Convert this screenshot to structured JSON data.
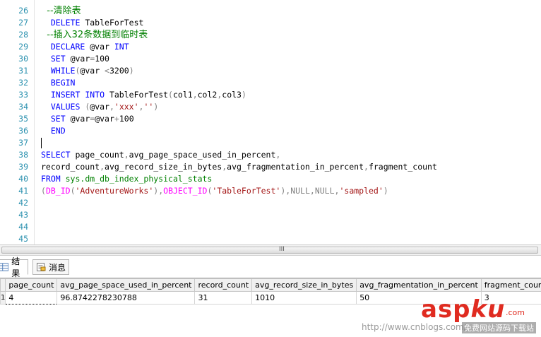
{
  "editor": {
    "lines": [
      {
        "n": "26",
        "segments": [
          {
            "t": "  --清除表",
            "c": "cmt"
          }
        ]
      },
      {
        "n": "27",
        "segments": [
          {
            "t": "  ",
            "c": ""
          },
          {
            "t": "DELETE",
            "c": "kw"
          },
          {
            "t": " TableForTest",
            "c": ""
          }
        ]
      },
      {
        "n": "28",
        "segments": [
          {
            "t": "  --插入32条数据到临时表",
            "c": "cmt"
          }
        ]
      },
      {
        "n": "29",
        "segments": [
          {
            "t": "  ",
            "c": ""
          },
          {
            "t": "DECLARE",
            "c": "kw"
          },
          {
            "t": " @var ",
            "c": ""
          },
          {
            "t": "INT",
            "c": "kw"
          }
        ]
      },
      {
        "n": "30",
        "segments": [
          {
            "t": "  ",
            "c": ""
          },
          {
            "t": "SET",
            "c": "kw"
          },
          {
            "t": " @var",
            "c": ""
          },
          {
            "t": "=",
            "c": "gray"
          },
          {
            "t": "100",
            "c": ""
          }
        ]
      },
      {
        "n": "31",
        "segments": [
          {
            "t": "  ",
            "c": ""
          },
          {
            "t": "WHILE",
            "c": "kw"
          },
          {
            "t": "(",
            "c": "gray"
          },
          {
            "t": "@var ",
            "c": ""
          },
          {
            "t": "<",
            "c": "gray"
          },
          {
            "t": "3200",
            "c": ""
          },
          {
            "t": ")",
            "c": "gray"
          }
        ]
      },
      {
        "n": "32",
        "segments": [
          {
            "t": "  ",
            "c": ""
          },
          {
            "t": "BEGIN",
            "c": "kw"
          }
        ]
      },
      {
        "n": "33",
        "segments": [
          {
            "t": "  ",
            "c": ""
          },
          {
            "t": "INSERT INTO",
            "c": "kw"
          },
          {
            "t": " TableForTest",
            "c": ""
          },
          {
            "t": "(",
            "c": "gray"
          },
          {
            "t": "col1",
            "c": ""
          },
          {
            "t": ",",
            "c": "gray"
          },
          {
            "t": "col2",
            "c": ""
          },
          {
            "t": ",",
            "c": "gray"
          },
          {
            "t": "col3",
            "c": ""
          },
          {
            "t": ")",
            "c": "gray"
          }
        ]
      },
      {
        "n": "34",
        "segments": [
          {
            "t": "  ",
            "c": ""
          },
          {
            "t": "VALUES",
            "c": "kw"
          },
          {
            "t": " (",
            "c": "gray"
          },
          {
            "t": "@var",
            "c": ""
          },
          {
            "t": ",",
            "c": "gray"
          },
          {
            "t": "'xxx'",
            "c": "str"
          },
          {
            "t": ",",
            "c": "gray"
          },
          {
            "t": "''",
            "c": "str"
          },
          {
            "t": ")",
            "c": "gray"
          }
        ]
      },
      {
        "n": "35",
        "segments": [
          {
            "t": "  ",
            "c": ""
          },
          {
            "t": "SET",
            "c": "kw"
          },
          {
            "t": " @var",
            "c": ""
          },
          {
            "t": "=",
            "c": "gray"
          },
          {
            "t": "@var",
            "c": ""
          },
          {
            "t": "+",
            "c": "gray"
          },
          {
            "t": "100",
            "c": ""
          }
        ]
      },
      {
        "n": "36",
        "segments": [
          {
            "t": "  ",
            "c": ""
          },
          {
            "t": "END",
            "c": "kw"
          }
        ]
      },
      {
        "n": "37",
        "segments": []
      },
      {
        "n": "38",
        "segments": [
          {
            "t": "SELECT",
            "c": "kw"
          },
          {
            "t": " page_count",
            "c": ""
          },
          {
            "t": ",",
            "c": "gray"
          },
          {
            "t": "avg_page_space_used_in_percent",
            "c": ""
          },
          {
            "t": ",",
            "c": "gray"
          }
        ]
      },
      {
        "n": "39",
        "segments": [
          {
            "t": "record_count",
            "c": ""
          },
          {
            "t": ",",
            "c": "gray"
          },
          {
            "t": "avg_record_size_in_bytes",
            "c": ""
          },
          {
            "t": ",",
            "c": "gray"
          },
          {
            "t": "avg_fragmentation_in_percent",
            "c": ""
          },
          {
            "t": ",",
            "c": "gray"
          },
          {
            "t": "fragment_count",
            "c": ""
          }
        ]
      },
      {
        "n": "40",
        "segments": [
          {
            "t": "FROM",
            "c": "kw"
          },
          {
            "t": " sys.dm_db_index_physical_stats",
            "c": "sys"
          }
        ]
      },
      {
        "n": "41",
        "segments": [
          {
            "t": "(",
            "c": "gray"
          },
          {
            "t": "DB_ID",
            "c": "fn"
          },
          {
            "t": "(",
            "c": "gray"
          },
          {
            "t": "'AdventureWorks'",
            "c": "str"
          },
          {
            "t": "),",
            "c": "gray"
          },
          {
            "t": "OBJECT_ID",
            "c": "fn"
          },
          {
            "t": "(",
            "c": "gray"
          },
          {
            "t": "'TableForTest'",
            "c": "str"
          },
          {
            "t": "),",
            "c": "gray"
          },
          {
            "t": "NULL",
            "c": "gray"
          },
          {
            "t": ",",
            "c": "gray"
          },
          {
            "t": "NULL",
            "c": "gray"
          },
          {
            "t": ",",
            "c": "gray"
          },
          {
            "t": "'sampled'",
            "c": "str"
          },
          {
            "t": ")",
            "c": "gray"
          }
        ]
      },
      {
        "n": "42",
        "segments": []
      },
      {
        "n": "43",
        "segments": []
      },
      {
        "n": "44",
        "segments": []
      },
      {
        "n": "45",
        "segments": []
      }
    ]
  },
  "scrollbar": {
    "grip": "III"
  },
  "tabs": [
    {
      "label": "结果",
      "active": true,
      "icon": "grid-icon"
    },
    {
      "label": "消息",
      "active": false,
      "icon": "message-icon"
    }
  ],
  "results": {
    "columns": [
      "page_count",
      "avg_page_space_used_in_percent",
      "record_count",
      "avg_record_size_in_bytes",
      "avg_fragmentation_in_percent",
      "fragment_count"
    ],
    "rows": [
      {
        "row_number": "1",
        "cells": [
          "4",
          "96.8742278230788",
          "31",
          "1010",
          "50",
          "3"
        ]
      }
    ]
  },
  "watermark": {
    "asp": "asp",
    "ku": "ku",
    "dot_com": ".com",
    "site": "http://www.cnblogs.com/",
    "sub": "免费网站源码下载站"
  },
  "colors": {
    "keyword": "#0000ff",
    "string": "#a31515",
    "function": "#ff00ff",
    "system": "#008000",
    "line_number": "#2b91af",
    "comment": "#008000"
  }
}
